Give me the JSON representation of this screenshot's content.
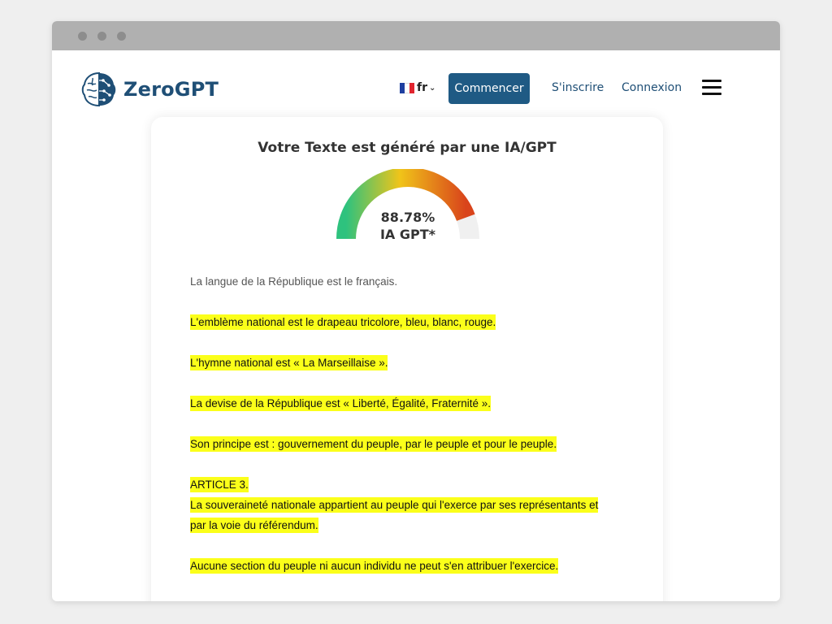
{
  "colors": {
    "brand": "#1f4f76",
    "button": "#1f5a84",
    "highlight": "#fbff1a",
    "gauge_start": "#2ec27e",
    "gauge_mid": "#f0c419",
    "gauge_end": "#d9441b"
  },
  "header": {
    "logo_text": "ZeroGPT",
    "language": "fr",
    "start_label": "Commencer",
    "signup_label": "S'inscrire",
    "login_label": "Connexion",
    "menu_icon": "hamburger-icon"
  },
  "result": {
    "title": "Votre Texte est généré par une IA/GPT",
    "percent": 88.78,
    "percent_label": "88.78%",
    "gauge_caption": "IA GPT*"
  },
  "text_paragraphs": [
    {
      "lines": [
        "La langue de la République est le français."
      ],
      "highlighted": false
    },
    {
      "lines": [
        "L'emblème national est le drapeau tricolore, bleu, blanc, rouge."
      ],
      "highlighted": true
    },
    {
      "lines": [
        "L'hymne national est « La Marseillaise »."
      ],
      "highlighted": true
    },
    {
      "lines": [
        "La devise de la République est « Liberté, Égalité, Fraternité »."
      ],
      "highlighted": true
    },
    {
      "lines": [
        "Son principe est : gouvernement du peuple, par le peuple et pour le peuple."
      ],
      "highlighted": true
    },
    {
      "lines": [
        "ARTICLE 3.",
        "La souveraineté nationale appartient au peuple qui l'exerce par ses représentants et",
        "par la voie du référendum."
      ],
      "highlighted": true
    },
    {
      "lines": [
        "Aucune section du peuple ni aucun individu ne peut s'en attribuer l'exercice."
      ],
      "highlighted": true
    }
  ]
}
